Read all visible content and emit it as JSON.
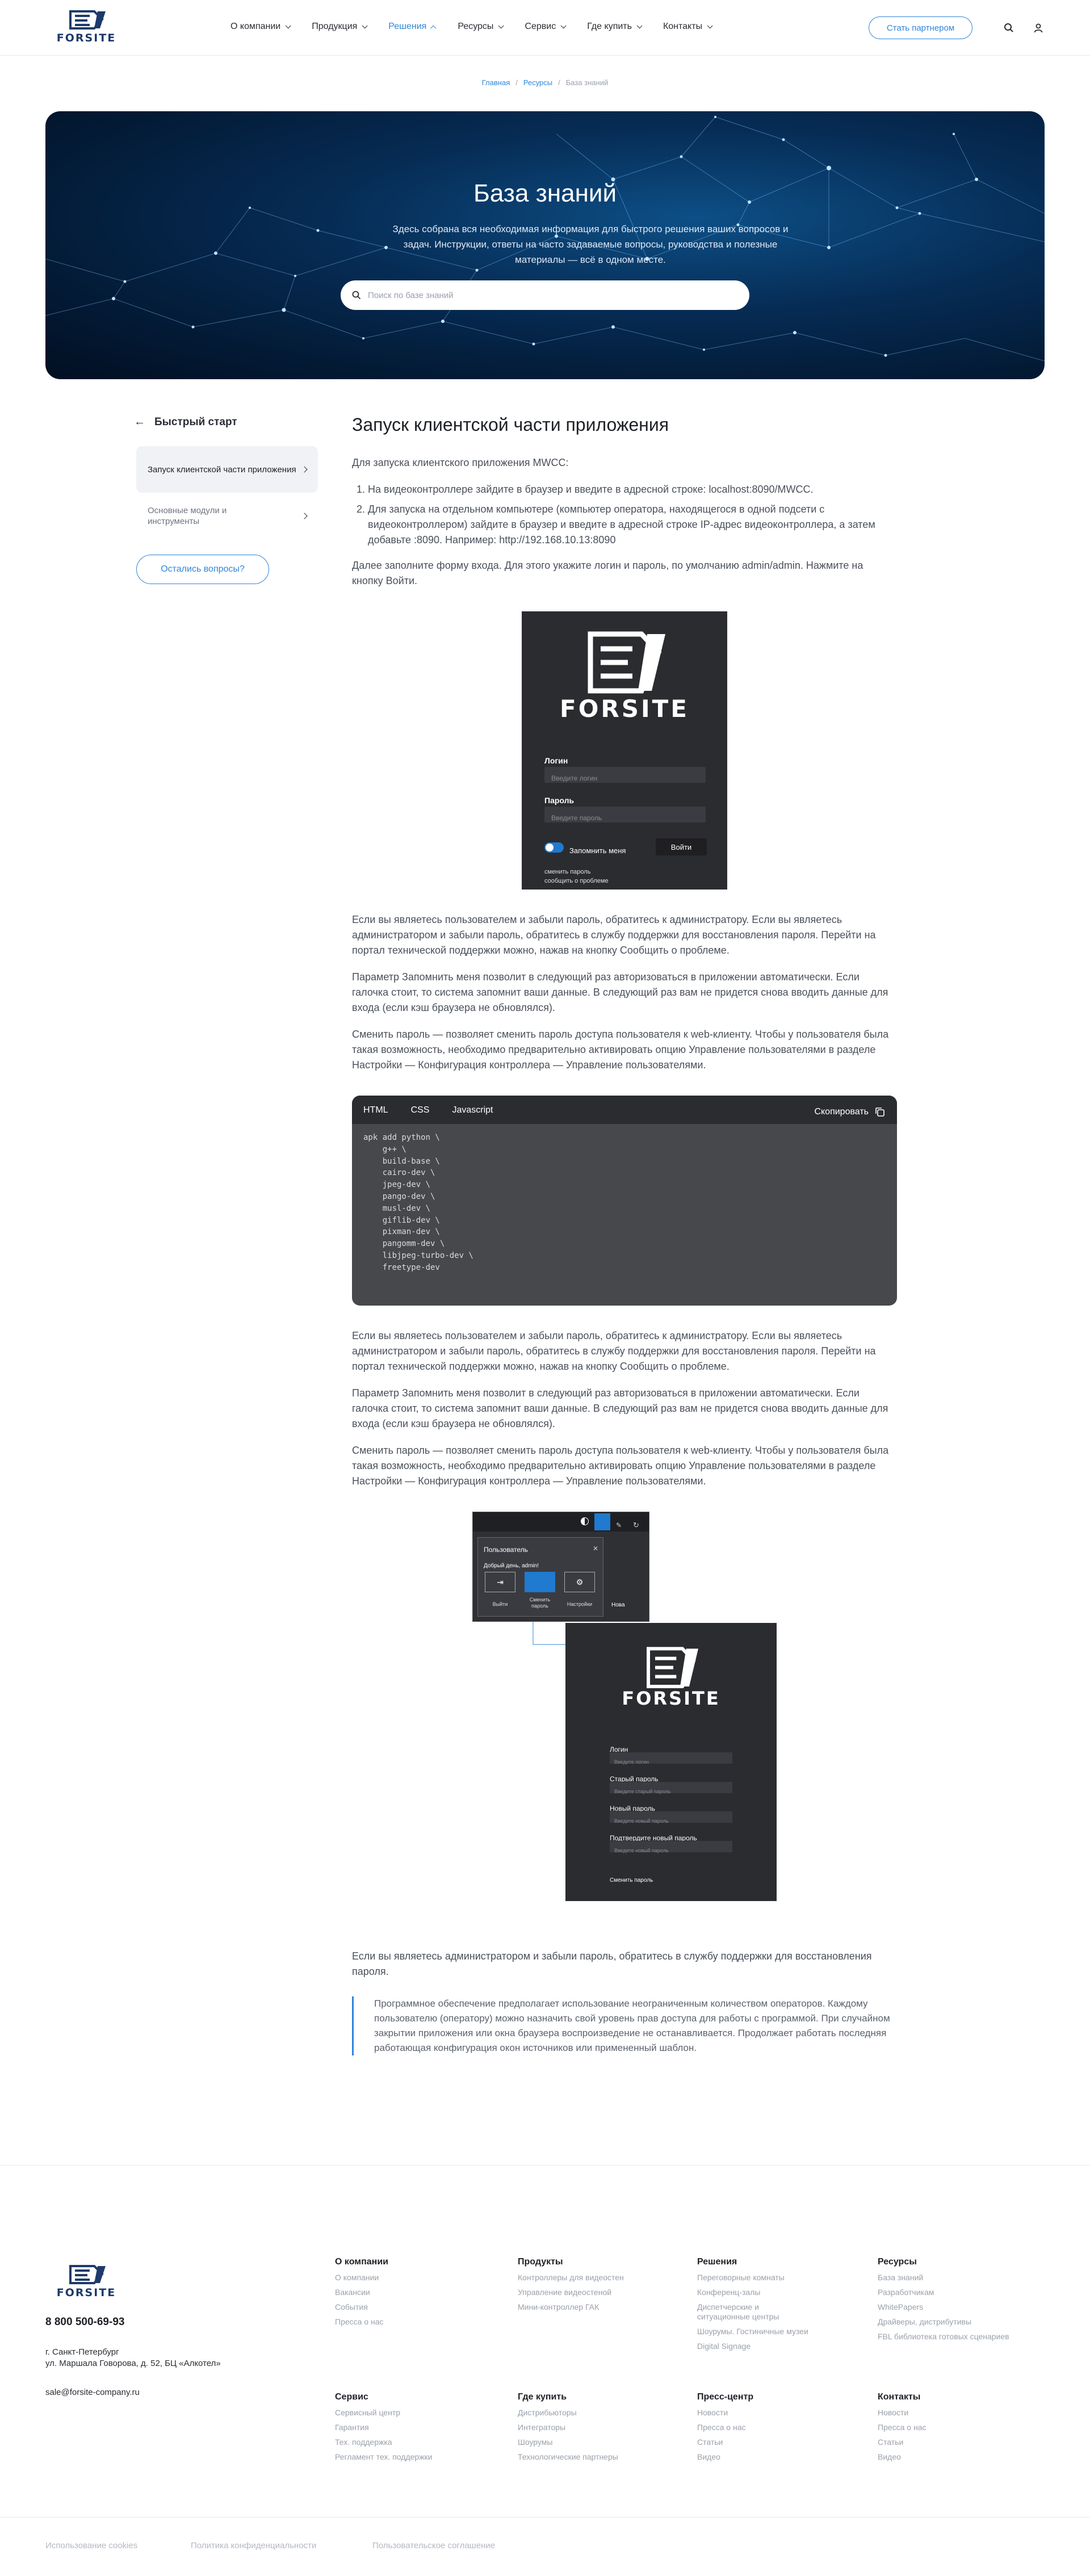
{
  "header": {
    "logo_text": "FORSITE",
    "nav": [
      {
        "label": "О компании",
        "active": false
      },
      {
        "label": "Продукция",
        "active": false
      },
      {
        "label": "Решения",
        "active": true
      },
      {
        "label": "Ресурсы",
        "active": false
      },
      {
        "label": "Сервис",
        "active": false
      },
      {
        "label": "Где купить",
        "active": false
      },
      {
        "label": "Контакты",
        "active": false
      }
    ],
    "partner_button": "Стать партнером",
    "icons": [
      "search-icon",
      "user-icon"
    ]
  },
  "breadcrumb": [
    "Главная",
    "Ресурсы",
    "База знаний"
  ],
  "hero": {
    "title": "База знаний",
    "subtitle": "Здесь собрана вся необходимая информация для быстрого решения ваших вопросов и задач. Инструкции, ответы на часто задаваемые вопросы, руководства и полезные материалы — всё в одном месте.",
    "search_placeholder": "Поиск по базе знаний"
  },
  "sidebar": {
    "back_label": "Быстрый старт",
    "items": [
      {
        "label": "Запуск клиентской части приложения",
        "active": true
      },
      {
        "label": "Основные модули и инструменты",
        "active": false
      }
    ],
    "question_button": "Остались вопросы?"
  },
  "article": {
    "title": "Запуск клиентской части приложения",
    "intro": "Для запуска клиентского приложения MWCC:",
    "steps": [
      "На видеоконтроллере зайдите в браузер и введите в адресной строке: localhost:8090/MWCC.",
      "Для запуска на отдельном компьютере (компьютер оператора, находящегося в одной подсети с видеоконтроллером) зайдите в браузер и введите в адресной строке IP-адрес видеоконтроллера, а затем добавьте :8090. Например: http://192.168.10.13:8090"
    ],
    "after_steps": "Далее заполните форму входа. Для этого укажите логин и пароль, по умолчанию admin/admin. Нажмите на кнопку Войти.",
    "login_shot": {
      "brand": "FORSITE",
      "login_label": "Логин",
      "login_placeholder": "Введите логин",
      "password_label": "Пароль",
      "password_placeholder": "Введите пароль",
      "remember": "Запомнить меня",
      "submit": "Войти",
      "change_password": "сменить пароль",
      "report_problem": "сообщить о проблеме"
    },
    "p_forgot": "Если вы являетесь пользователем и забыли пароль, обратитесь к администратору. Если вы являетесь администратором и забыли пароль, обратитесь в службу поддержки для восстановления пароля. Перейти на портал технической поддержки можно, нажав на кнопку Сообщить о проблеме.",
    "p_remember": "Параметр Запомнить меня позволит в следующий раз авторизоваться в приложении автоматически. Если галочка стоит, то система запомнит ваши данные. В следующий раз вам не придется снова вводить данные для входа (если кэш браузера не обновлялся).",
    "p_change": "Сменить пароль — позволяет сменить пароль доступа пользователя к web-клиенту. Чтобы у пользователя была такая возможность, необходимо предварительно активировать опцию Управление пользователями в разделе Настройки — Конфигурация контроллера — Управление пользователями.",
    "code": {
      "tabs": [
        "HTML",
        "CSS",
        "Javascript"
      ],
      "copy": "Скопировать",
      "text": "apk add python \\\n    g++ \\\n    build-base \\\n    cairo-dev \\\n    jpeg-dev \\\n    pango-dev \\\n    musl-dev \\\n    giflib-dev \\\n    pixman-dev \\\n    pangomm-dev \\\n    libjpeg-turbo-dev \\\n    freetype-dev"
    },
    "p_forgot2": "Если вы являетесь пользователем и забыли пароль, обратитесь к администратору. Если вы являетесь администратором и забыли пароль, обратитесь в службу поддержки для восстановления пароля. Перейти на портал технической поддержки можно, нажав на кнопку Сообщить о проблеме.",
    "p_remember2": "Параметр Запомнить меня позволит в следующий раз авторизоваться в приложении автоматически. Если галочка стоит, то система запомнит ваши данные. В следующий раз вам не придется снова вводить данные для входа (если кэш браузера не обновлялся).",
    "p_change2": "Сменить пароль — позволяет сменить пароль доступа пользователя к web-клиенту. Чтобы у пользователя была такая возможность, необходимо предварительно активировать опцию Управление пользователями в разделе Настройки — Конфигурация контроллера — Управление пользователями.",
    "change_shot": {
      "popup_title": "Пользователь",
      "popup_greeting": "Добрый день, admin!",
      "popup_actions": [
        "Выйти",
        "Сменить пароль",
        "Настройки"
      ],
      "side_label": "Нова",
      "brand": "FORSITE",
      "fields": [
        {
          "label": "Логин",
          "placeholder": "Введите логин"
        },
        {
          "label": "Старый пароль",
          "placeholder": "Введите старый пароль"
        },
        {
          "label": "Новый пароль",
          "placeholder": "Введите новый пароль"
        },
        {
          "label": "Подтвердите новый пароль",
          "placeholder": "Введите новый пароль"
        }
      ],
      "submit": "Сменить пароль"
    },
    "p_admin": "Если вы являетесь администратором и забыли пароль, обратитесь в службу поддержки для восстановления пароля.",
    "quote": "Программное обеспечение предполагает использование неограниченным количеством операторов. Каждому пользователю (оператору) можно назначить свой уровень прав доступа для работы с программой.  При случайном закрытии приложения или окна браузера воспроизведение не останавливается. Продолжает работать последняя работающая конфигурация окон источников или примененный шаблон."
  },
  "footer": {
    "brand": "FORSITE",
    "phone": "8 800 500-69-93",
    "address_city": "г. Санкт-Петербург",
    "address_street": "ул. Маршала Говорова, д. 52, БЦ «Алкотел»",
    "email": "sale@forsite-company.ru",
    "columns": [
      {
        "title": "О компании",
        "links": [
          "О компании",
          "Вакансии",
          "События",
          "Пресса о нас"
        ]
      },
      {
        "title": "Продукты",
        "links": [
          "Контроллеры для видеостен",
          "Управление видеостеной",
          "Мини-контроллер ГАК"
        ]
      },
      {
        "title": "Решения",
        "links": [
          "Переговорные комнаты",
          "Конференц-залы",
          "Диспетчерские и ситуационные центры",
          "Шоурумы. Гостиничные музеи",
          "Digital Signage"
        ]
      },
      {
        "title": "Ресурсы",
        "links": [
          "База знаний",
          "Разработчикам",
          "WhitePapers",
          "Драйверы, дистрибутивы",
          "FBL библиотека готовых сценариев"
        ]
      },
      {
        "title": "Сервис",
        "links": [
          "Сервисный центр",
          "Гарантия",
          "Тех. поддержка",
          "Регламент тех. поддержки"
        ]
      },
      {
        "title": "Где купить",
        "links": [
          "Дистрибьюторы",
          "Интеграторы",
          "Шоурумы",
          "Технологические партнеры"
        ]
      },
      {
        "title": "Пресс-центр",
        "links": [
          "Новости",
          "Пресса о нас",
          "Статьи",
          "Видео"
        ]
      },
      {
        "title": "Контакты",
        "links": [
          "Новости",
          "Пресса о нас",
          "Статьи",
          "Видео"
        ]
      }
    ],
    "legal": [
      "Использование cookies",
      "Политика конфиденциальности",
      "Пользовательское соглашение"
    ]
  },
  "colors": {
    "accent": "#2f86d8",
    "brand": "#1d3a6b",
    "hero_bg": "#062c55"
  }
}
